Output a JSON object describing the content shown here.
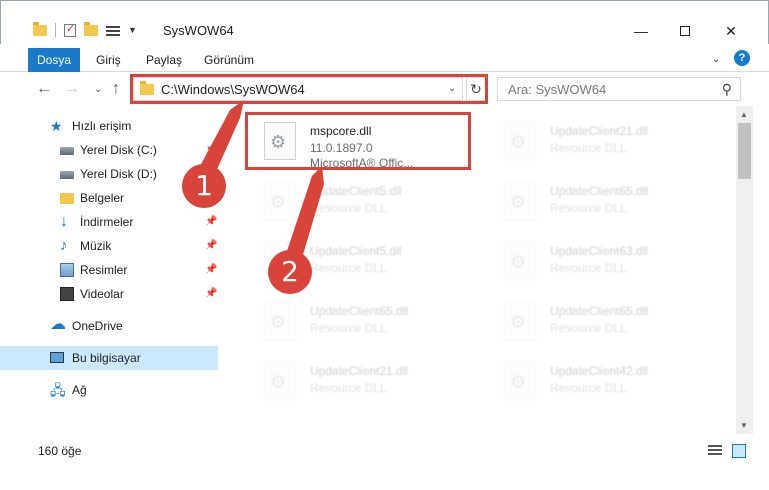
{
  "window": {
    "title": "SysWOW64",
    "controls": {
      "minimize": "—",
      "maximize": "",
      "close": "✕"
    }
  },
  "ribbon": {
    "tabs": [
      {
        "label": "Dosya"
      },
      {
        "label": "Giriş"
      },
      {
        "label": "Paylaş"
      },
      {
        "label": "Görünüm"
      }
    ],
    "help": "?"
  },
  "nav": {
    "address": "C:\\Windows\\SysWOW64",
    "search_placeholder": "Ara: SysWOW64"
  },
  "sidebar": {
    "items": [
      {
        "label": "Hızlı erişim",
        "icon": "star-icon"
      },
      {
        "label": "Yerel Disk (C:)",
        "icon": "disk-icon",
        "pinned": true
      },
      {
        "label": "Yerel Disk (D:)",
        "icon": "disk-icon",
        "pinned": true
      },
      {
        "label": "Belgeler",
        "icon": "documents-icon",
        "pinned": true
      },
      {
        "label": "İndirmeler",
        "icon": "downloads-icon",
        "pinned": true
      },
      {
        "label": "Müzik",
        "icon": "music-icon",
        "pinned": true
      },
      {
        "label": "Resimler",
        "icon": "pictures-icon",
        "pinned": true
      },
      {
        "label": "Videolar",
        "icon": "videos-icon",
        "pinned": true
      },
      {
        "label": "OneDrive",
        "icon": "onedrive-icon"
      },
      {
        "label": "Bu bilgisayar",
        "icon": "computer-icon",
        "selected": true
      },
      {
        "label": "Ağ",
        "icon": "network-icon"
      }
    ]
  },
  "files": {
    "main": {
      "name": "mspcore.dll",
      "version": "11.0.1897.0",
      "company": "MicrosoftA® Offic..."
    },
    "ghosts": [
      {
        "name": "UpdateClient21.dll",
        "type": "Resource DLL"
      },
      {
        "name": "UpdateClient5.dll",
        "type": "Resource DLL"
      },
      {
        "name": "UpdateClient65.dll",
        "type": "Resource DLL"
      },
      {
        "name": "UpdateClient5.dll",
        "type": "Resource DLL"
      },
      {
        "name": "UpdateClient63.dll",
        "type": "Resource DLL"
      },
      {
        "name": "UpdateClient65.dll",
        "type": "Resource DLL"
      },
      {
        "name": "UpdateClient65.dll",
        "type": "Resource DLL"
      },
      {
        "name": "UpdateClient21.dll",
        "type": "Resource DLL"
      },
      {
        "name": "UpdateClient42.dll",
        "type": "Resource DLL"
      }
    ]
  },
  "status": {
    "count": "160 öğe"
  },
  "annotations": {
    "badge1": "1",
    "badge2": "2",
    "color": "#d9443a"
  }
}
